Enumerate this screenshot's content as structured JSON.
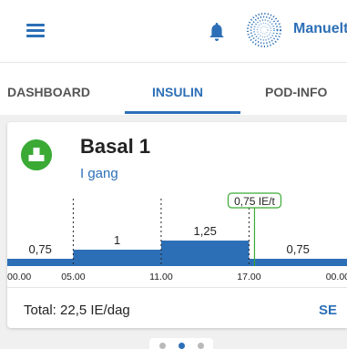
{
  "header": {
    "mode_label": "Manuelt"
  },
  "tabs": [
    {
      "label": "DASHBOARD"
    },
    {
      "label": "INSULIN"
    },
    {
      "label": "POD-INFO"
    }
  ],
  "card": {
    "program_name": "Basal 1",
    "status": "I gang",
    "total": "Total:  22,5 IE/dag",
    "see_label": "SE"
  },
  "chart_data": {
    "type": "step",
    "segments": [
      {
        "start": "00.00",
        "end": "05.00",
        "rate": 0.75,
        "label": "0,75"
      },
      {
        "start": "05.00",
        "end": "11.00",
        "rate": 1,
        "label": "1"
      },
      {
        "start": "11.00",
        "end": "17.00",
        "rate": 1.25,
        "label": "1,25"
      },
      {
        "start": "17.00",
        "end": "24.00",
        "rate": 0.75,
        "label": "0,75"
      }
    ],
    "x_ticks": [
      "00.00",
      "05.00",
      "11.00",
      "17.00",
      "00.00"
    ],
    "current_rate_label": "0,75 IE/t",
    "current_time": "17.30",
    "colors": {
      "bar": "#2c6fb7",
      "marker": "#3aaa35",
      "accent": "#2c6fb7",
      "basal_icon": "#3aaa35"
    }
  },
  "pager": {
    "active_index": 1,
    "count": 3
  }
}
